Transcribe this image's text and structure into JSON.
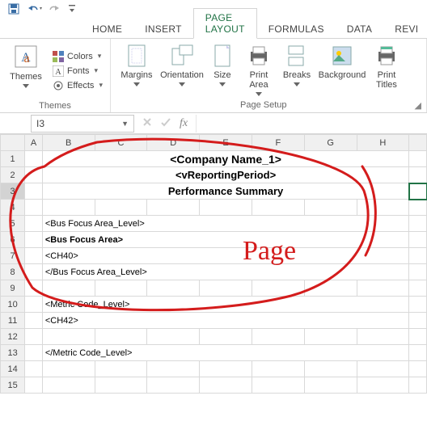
{
  "tabs": {
    "home": "HOME",
    "insert": "INSERT",
    "pagelayout": "PAGE LAYOUT",
    "formulas": "FORMULAS",
    "data": "DATA",
    "review": "REVI"
  },
  "ribbon": {
    "themes": {
      "btn": "Themes",
      "colors": "Colors",
      "fonts": "Fonts",
      "effects": "Effects",
      "group": "Themes"
    },
    "pagesetup": {
      "margins": "Margins",
      "orientation": "Orientation",
      "size": "Size",
      "printarea": "Print\nArea",
      "breaks": "Breaks",
      "background": "Background",
      "printtitles": "Print\nTitles",
      "group": "Page Setup"
    }
  },
  "namebox": "I3",
  "fx": "fx",
  "cols": {
    "A": "A",
    "B": "B",
    "C": "C",
    "D": "D",
    "E": "E",
    "F": "F",
    "G": "G",
    "H": "H"
  },
  "rows": {
    "r1": {
      "text": "<Company Name_1>"
    },
    "r2": {
      "text": "<vReportingPeriod>"
    },
    "r3": {
      "text": "Performance Summary"
    },
    "r5": {
      "text": "<Bus Focus Area_Level>"
    },
    "r6": {
      "text": "<Bus Focus Area>"
    },
    "r7": {
      "text": "<CH40>"
    },
    "r8": {
      "text": "</Bus Focus Area_Level>"
    },
    "r10": {
      "text": "<Metric Code_Level>"
    },
    "r11": {
      "text": "<CH42>"
    },
    "r13": {
      "text": "</Metric Code_Level>"
    }
  },
  "rownums": [
    "1",
    "2",
    "3",
    "4",
    "5",
    "6",
    "7",
    "8",
    "9",
    "10",
    "11",
    "12",
    "13",
    "14",
    "15"
  ],
  "annotation": "Page"
}
